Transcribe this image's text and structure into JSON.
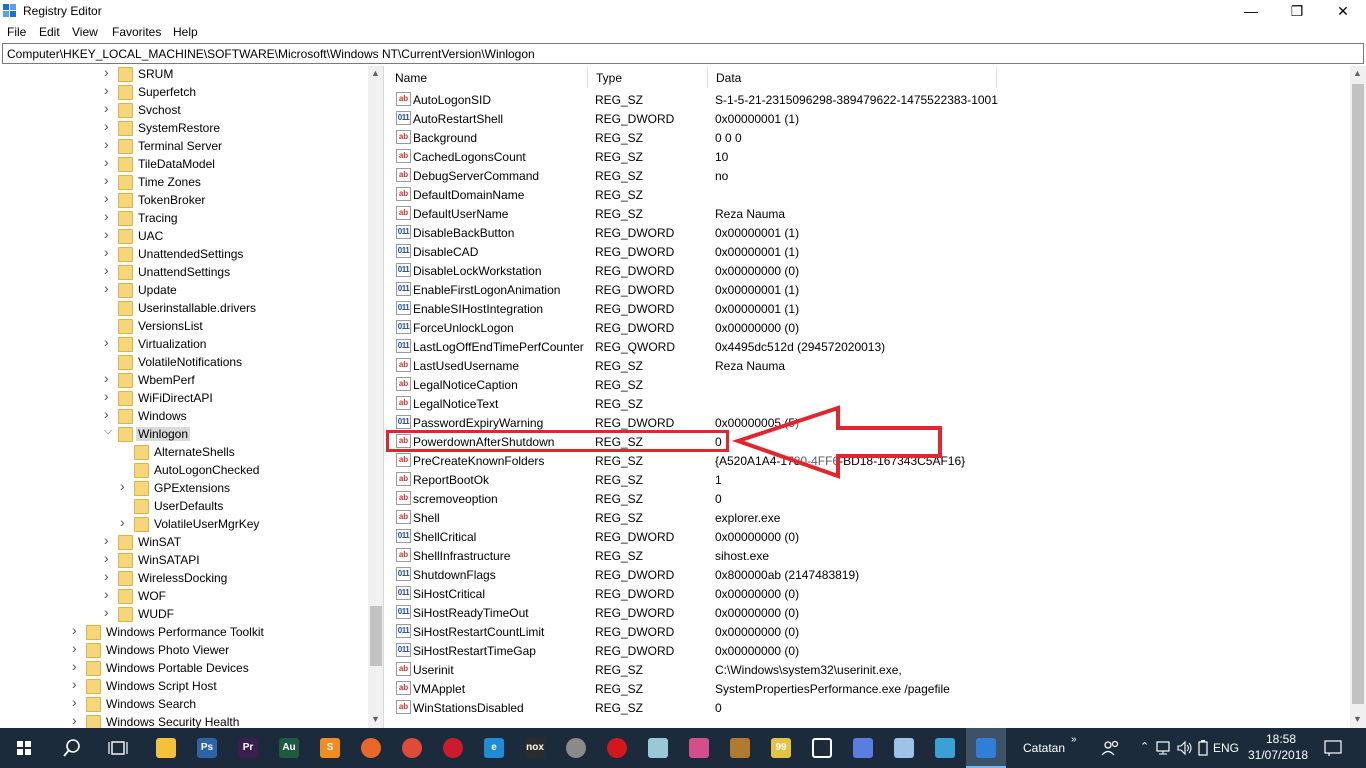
{
  "window": {
    "title": "Registry Editor",
    "minimize": "—",
    "maximize": "❐",
    "close": "✕"
  },
  "menu": [
    "File",
    "Edit",
    "View",
    "Favorites",
    "Help"
  ],
  "address": "Computer\\HKEY_LOCAL_MACHINE\\SOFTWARE\\Microsoft\\Windows NT\\CurrentVersion\\Winlogon",
  "tree": [
    {
      "label": "SRUM",
      "level": 2,
      "state": "collapsed"
    },
    {
      "label": "Superfetch",
      "level": 2,
      "state": "collapsed"
    },
    {
      "label": "Svchost",
      "level": 2,
      "state": "collapsed"
    },
    {
      "label": "SystemRestore",
      "level": 2,
      "state": "collapsed"
    },
    {
      "label": "Terminal Server",
      "level": 2,
      "state": "collapsed"
    },
    {
      "label": "TileDataModel",
      "level": 2,
      "state": "collapsed"
    },
    {
      "label": "Time Zones",
      "level": 2,
      "state": "collapsed"
    },
    {
      "label": "TokenBroker",
      "level": 2,
      "state": "collapsed"
    },
    {
      "label": "Tracing",
      "level": 2,
      "state": "collapsed"
    },
    {
      "label": "UAC",
      "level": 2,
      "state": "collapsed"
    },
    {
      "label": "UnattendedSettings",
      "level": 2,
      "state": "collapsed"
    },
    {
      "label": "UnattendSettings",
      "level": 2,
      "state": "collapsed"
    },
    {
      "label": "Update",
      "level": 2,
      "state": "collapsed"
    },
    {
      "label": "Userinstallable.drivers",
      "level": 2,
      "state": "none"
    },
    {
      "label": "VersionsList",
      "level": 2,
      "state": "none"
    },
    {
      "label": "Virtualization",
      "level": 2,
      "state": "collapsed"
    },
    {
      "label": "VolatileNotifications",
      "level": 2,
      "state": "none"
    },
    {
      "label": "WbemPerf",
      "level": 2,
      "state": "collapsed"
    },
    {
      "label": "WiFiDirectAPI",
      "level": 2,
      "state": "collapsed"
    },
    {
      "label": "Windows",
      "level": 2,
      "state": "collapsed"
    },
    {
      "label": "Winlogon",
      "level": 2,
      "state": "expanded",
      "selected": true
    },
    {
      "label": "AlternateShells",
      "level": 3,
      "state": "none"
    },
    {
      "label": "AutoLogonChecked",
      "level": 3,
      "state": "none"
    },
    {
      "label": "GPExtensions",
      "level": 3,
      "state": "collapsed"
    },
    {
      "label": "UserDefaults",
      "level": 3,
      "state": "none"
    },
    {
      "label": "VolatileUserMgrKey",
      "level": 3,
      "state": "collapsed"
    },
    {
      "label": "WinSAT",
      "level": 2,
      "state": "collapsed"
    },
    {
      "label": "WinSATAPI",
      "level": 2,
      "state": "collapsed"
    },
    {
      "label": "WirelessDocking",
      "level": 2,
      "state": "collapsed"
    },
    {
      "label": "WOF",
      "level": 2,
      "state": "collapsed"
    },
    {
      "label": "WUDF",
      "level": 2,
      "state": "collapsed"
    },
    {
      "label": "Windows Performance Toolkit",
      "level": 1,
      "state": "collapsed"
    },
    {
      "label": "Windows Photo Viewer",
      "level": 1,
      "state": "collapsed"
    },
    {
      "label": "Windows Portable Devices",
      "level": 1,
      "state": "collapsed"
    },
    {
      "label": "Windows Script Host",
      "level": 1,
      "state": "collapsed"
    },
    {
      "label": "Windows Search",
      "level": 1,
      "state": "collapsed"
    },
    {
      "label": "Windows Security Health",
      "level": 1,
      "state": "collapsed"
    }
  ],
  "columns": {
    "name": "Name",
    "type": "Type",
    "data": "Data"
  },
  "values": [
    {
      "icon": "sz",
      "name": "AutoLogonSID",
      "type": "REG_SZ",
      "data": "S-1-5-21-2315096298-389479622-1475522383-1001"
    },
    {
      "icon": "bin",
      "name": "AutoRestartShell",
      "type": "REG_DWORD",
      "data": "0x00000001 (1)"
    },
    {
      "icon": "sz",
      "name": "Background",
      "type": "REG_SZ",
      "data": "0 0 0"
    },
    {
      "icon": "sz",
      "name": "CachedLogonsCount",
      "type": "REG_SZ",
      "data": "10"
    },
    {
      "icon": "sz",
      "name": "DebugServerCommand",
      "type": "REG_SZ",
      "data": "no"
    },
    {
      "icon": "sz",
      "name": "DefaultDomainName",
      "type": "REG_SZ",
      "data": ""
    },
    {
      "icon": "sz",
      "name": "DefaultUserName",
      "type": "REG_SZ",
      "data": "Reza Nauma"
    },
    {
      "icon": "bin",
      "name": "DisableBackButton",
      "type": "REG_DWORD",
      "data": "0x00000001 (1)"
    },
    {
      "icon": "bin",
      "name": "DisableCAD",
      "type": "REG_DWORD",
      "data": "0x00000001 (1)"
    },
    {
      "icon": "bin",
      "name": "DisableLockWorkstation",
      "type": "REG_DWORD",
      "data": "0x00000000 (0)"
    },
    {
      "icon": "bin",
      "name": "EnableFirstLogonAnimation",
      "type": "REG_DWORD",
      "data": "0x00000001 (1)"
    },
    {
      "icon": "bin",
      "name": "EnableSIHostIntegration",
      "type": "REG_DWORD",
      "data": "0x00000001 (1)"
    },
    {
      "icon": "bin",
      "name": "ForceUnlockLogon",
      "type": "REG_DWORD",
      "data": "0x00000000 (0)"
    },
    {
      "icon": "bin",
      "name": "LastLogOffEndTimePerfCounter",
      "type": "REG_QWORD",
      "data": "0x4495dc512d (294572020013)"
    },
    {
      "icon": "sz",
      "name": "LastUsedUsername",
      "type": "REG_SZ",
      "data": "Reza Nauma"
    },
    {
      "icon": "sz",
      "name": "LegalNoticeCaption",
      "type": "REG_SZ",
      "data": ""
    },
    {
      "icon": "sz",
      "name": "LegalNoticeText",
      "type": "REG_SZ",
      "data": ""
    },
    {
      "icon": "bin",
      "name": "PasswordExpiryWarning",
      "type": "REG_DWORD",
      "data": "0x00000005 (5)"
    },
    {
      "icon": "sz",
      "name": "PowerdownAfterShutdown",
      "type": "REG_SZ",
      "data": "0"
    },
    {
      "icon": "sz",
      "name": "PreCreateKnownFolders",
      "type": "REG_SZ",
      "data": "{A520A1A4-1780-4FF6-BD18-167343C5AF16}"
    },
    {
      "icon": "sz",
      "name": "ReportBootOk",
      "type": "REG_SZ",
      "data": "1"
    },
    {
      "icon": "sz",
      "name": "scremoveoption",
      "type": "REG_SZ",
      "data": "0"
    },
    {
      "icon": "sz",
      "name": "Shell",
      "type": "REG_SZ",
      "data": "explorer.exe"
    },
    {
      "icon": "bin",
      "name": "ShellCritical",
      "type": "REG_DWORD",
      "data": "0x00000000 (0)"
    },
    {
      "icon": "sz",
      "name": "ShellInfrastructure",
      "type": "REG_SZ",
      "data": "sihost.exe"
    },
    {
      "icon": "bin",
      "name": "ShutdownFlags",
      "type": "REG_DWORD",
      "data": "0x800000ab (2147483819)"
    },
    {
      "icon": "bin",
      "name": "SiHostCritical",
      "type": "REG_DWORD",
      "data": "0x00000000 (0)"
    },
    {
      "icon": "bin",
      "name": "SiHostReadyTimeOut",
      "type": "REG_DWORD",
      "data": "0x00000000 (0)"
    },
    {
      "icon": "bin",
      "name": "SiHostRestartCountLimit",
      "type": "REG_DWORD",
      "data": "0x00000000 (0)"
    },
    {
      "icon": "bin",
      "name": "SiHostRestartTimeGap",
      "type": "REG_DWORD",
      "data": "0x00000000 (0)"
    },
    {
      "icon": "sz",
      "name": "Userinit",
      "type": "REG_SZ",
      "data": "C:\\Windows\\system32\\userinit.exe,"
    },
    {
      "icon": "sz",
      "name": "VMApplet",
      "type": "REG_SZ",
      "data": "SystemPropertiesPerformance.exe /pagefile"
    },
    {
      "icon": "sz",
      "name": "WinStationsDisabled",
      "type": "REG_SZ",
      "data": "0"
    }
  ],
  "value_icon_glyphs": {
    "sz": "ab",
    "bin": "011"
  },
  "colors": {
    "highlight": "#e3262e",
    "taskbar": "#1b2b3c",
    "folder": "#f6d67a"
  },
  "taskbar": {
    "apps": [
      {
        "name": "file-explorer-icon",
        "color": "#f3c13a"
      },
      {
        "name": "photoshop-icon",
        "color": "#2d63a8",
        "glyph": "Ps"
      },
      {
        "name": "premiere-icon",
        "color": "#3b1d4f",
        "glyph": "Pr"
      },
      {
        "name": "audition-icon",
        "color": "#1f5a3f",
        "glyph": "Au"
      },
      {
        "name": "sublime-icon",
        "color": "#f28c1e",
        "glyph": "S"
      },
      {
        "name": "firefox-icon",
        "color": "#e8672a"
      },
      {
        "name": "chrome-icon",
        "color": "#dd4b39"
      },
      {
        "name": "opera-icon",
        "color": "#cc1b2b"
      },
      {
        "name": "edge-icon",
        "color": "#1f8dd6",
        "glyph": "e"
      },
      {
        "name": "nox-icon",
        "color": "#2b2b2b",
        "glyph": "nox"
      },
      {
        "name": "film-reel-icon",
        "color": "#8a8a8a"
      },
      {
        "name": "record-icon",
        "color": "#d4161d"
      },
      {
        "name": "notebook-icon",
        "color": "#9bc8d6"
      },
      {
        "name": "paint-icon",
        "color": "#d24f8a"
      },
      {
        "name": "palette-icon",
        "color": "#b07a2f"
      },
      {
        "name": "monitor-icon",
        "color": "#e3c343",
        "glyph": "99"
      },
      {
        "name": "calculator-icon",
        "color": "#ffffff"
      },
      {
        "name": "diamond-app-icon",
        "color": "#5a7de0"
      },
      {
        "name": "gamepad-icon",
        "color": "#9fc2e8"
      },
      {
        "name": "dolphin-icon",
        "color": "#3aa0d8"
      },
      {
        "name": "regedit-icon",
        "color": "#2f7ed8"
      }
    ],
    "toolbar_label": "Catatan",
    "lang": "ENG",
    "time": "18:58",
    "date": "31/07/2018"
  }
}
